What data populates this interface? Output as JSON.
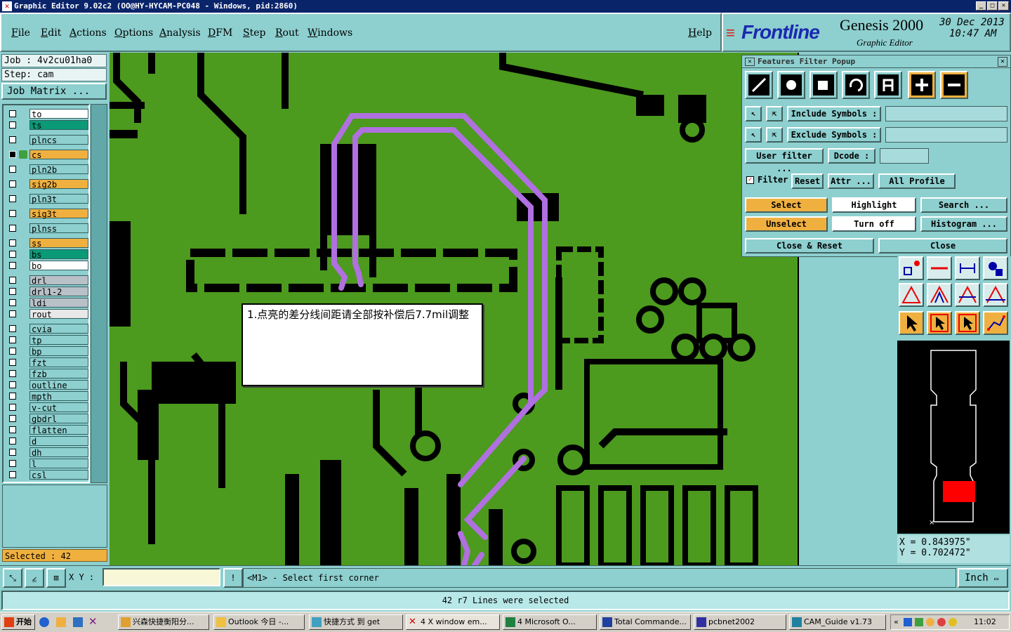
{
  "window": {
    "title": "Graphic Editor 9.02c2 (OO@HY-HYCAM-PC048 - Windows, pid:2860)"
  },
  "menu": {
    "items": [
      "File",
      "Edit",
      "Actions",
      "Options",
      "Analysis",
      "DFM",
      "Step",
      "Rout",
      "Windows"
    ],
    "help": "Help"
  },
  "brand": {
    "logo": "Frontline",
    "product": "Genesis 2000",
    "subtitle": "Graphic Editor",
    "date": "30 Dec 2013",
    "time": "10:47 AM"
  },
  "job": {
    "job_label": "Job : 4v2cu01ha0",
    "step_label": "Step: cam",
    "matrix_button": "Job Matrix ..."
  },
  "layers": [
    {
      "name": "to",
      "color": "#ffffff"
    },
    {
      "name": "ts",
      "color": "#0a9a78"
    },
    {
      "name": "plncs",
      "color": "#8ecfcf"
    },
    {
      "name": "cs",
      "color": "#f0b040",
      "active": true
    },
    {
      "name": "pln2b",
      "color": "#8ecfcf"
    },
    {
      "name": "sig2b",
      "color": "#f0b040"
    },
    {
      "name": "pln3t",
      "color": "#8ecfcf"
    },
    {
      "name": "sig3t",
      "color": "#f0b040"
    },
    {
      "name": "plnss",
      "color": "#8ecfcf"
    },
    {
      "name": "ss",
      "color": "#f0b040"
    },
    {
      "name": "bs",
      "color": "#0a9a78"
    },
    {
      "name": "bo",
      "color": "#ffffff"
    },
    {
      "name": "drl",
      "color": "#b8c0c8"
    },
    {
      "name": "drl1-2",
      "color": "#b8c0c8"
    },
    {
      "name": "ldi",
      "color": "#b8c0c8"
    },
    {
      "name": "rout",
      "color": "#e8e8e8"
    },
    {
      "name": "cvia",
      "color": "#8ecfcf"
    },
    {
      "name": "tp",
      "color": "#8ecfcf"
    },
    {
      "name": "bp",
      "color": "#8ecfcf"
    },
    {
      "name": "fzt",
      "color": "#8ecfcf"
    },
    {
      "name": "fzb",
      "color": "#8ecfcf"
    },
    {
      "name": "outline",
      "color": "#8ecfcf"
    },
    {
      "name": "mpth",
      "color": "#8ecfcf"
    },
    {
      "name": "v-cut",
      "color": "#8ecfcf"
    },
    {
      "name": "gbdrl",
      "color": "#8ecfcf"
    },
    {
      "name": "flatten",
      "color": "#8ecfcf"
    },
    {
      "name": "d",
      "color": "#8ecfcf"
    },
    {
      "name": "dh",
      "color": "#8ecfcf"
    },
    {
      "name": "l",
      "color": "#8ecfcf"
    },
    {
      "name": "csl",
      "color": "#8ecfcf"
    }
  ],
  "selected_label": "Selected : 42",
  "note": {
    "text": "1.点亮的差分线间距请全部按补偿后7.7mil调整"
  },
  "popup": {
    "title": "Features Filter Popup",
    "include_label": "Include Symbols :",
    "exclude_label": "Exclude Symbols :",
    "user_filter": "User filter ...",
    "dcode": "Dcode :",
    "filter": "Filter",
    "reset": "Reset",
    "attr": "Attr ...",
    "profile": "All Profile",
    "select": "Select",
    "highlight": "Highlight",
    "search": "Search ...",
    "unselect": "Unselect",
    "turn_off": "Turn off",
    "histogram": "Histogram ...",
    "close_reset": "Close & Reset",
    "close": "Close"
  },
  "coords": {
    "x": "X = 0.843975\"",
    "y": "Y = 0.702472\""
  },
  "cmd": {
    "xy_label": "X Y :",
    "xy_value": "",
    "prompt": "<M1> - Select first corner",
    "unit": "Inch"
  },
  "status": "42 r7 Lines were selected",
  "taskbar": {
    "start": "开始",
    "tasks": [
      "兴森快捷衡阳分...",
      "Outlook 今日 -...",
      "快捷方式 到 get",
      "4 X window em...",
      "4 Microsoft O...",
      "Total Commande...",
      "pcbnet2002",
      "CAM_Guide v1.73"
    ],
    "clock": "11:02"
  },
  "colors": {
    "board": "#4c9a1e",
    "trace": "#b070e0",
    "panel": "#8ecfcf",
    "accent": "#f0b040"
  }
}
